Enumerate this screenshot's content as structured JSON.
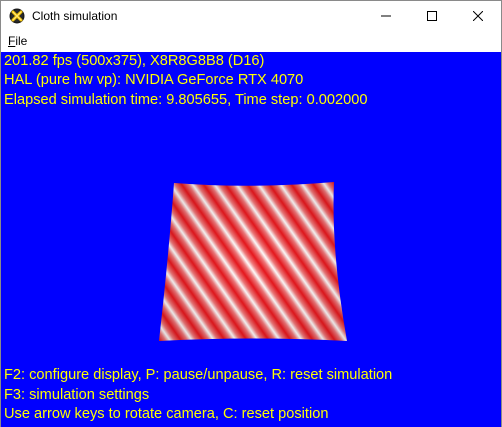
{
  "window": {
    "title": "Cloth simulation"
  },
  "menu": {
    "file_label": "F",
    "file_label_rest": "ile"
  },
  "hud": {
    "fps_line": "201.82 fps (500x375), X8R8G8B8 (D16)",
    "device_line": "HAL (pure hw vp): NVIDIA GeForce RTX 4070",
    "time_line": "Elapsed simulation time: 9.805655, Time step: 0.002000",
    "help_line_1": "F2: configure display, P: pause/unpause, R: reset simulation",
    "help_line_2": "F3: simulation settings",
    "help_line_3": "Use arrow keys to rotate camera, C: reset position"
  },
  "colors": {
    "viewport_background": "#0000ff",
    "hud_text": "#ffff00",
    "cloth_stripe_red": "#e8161c",
    "cloth_stripe_white": "#ffffff"
  },
  "icons": {
    "app": "directx-x-icon",
    "minimize": "minimize-icon",
    "maximize": "maximize-icon",
    "close": "close-icon"
  }
}
